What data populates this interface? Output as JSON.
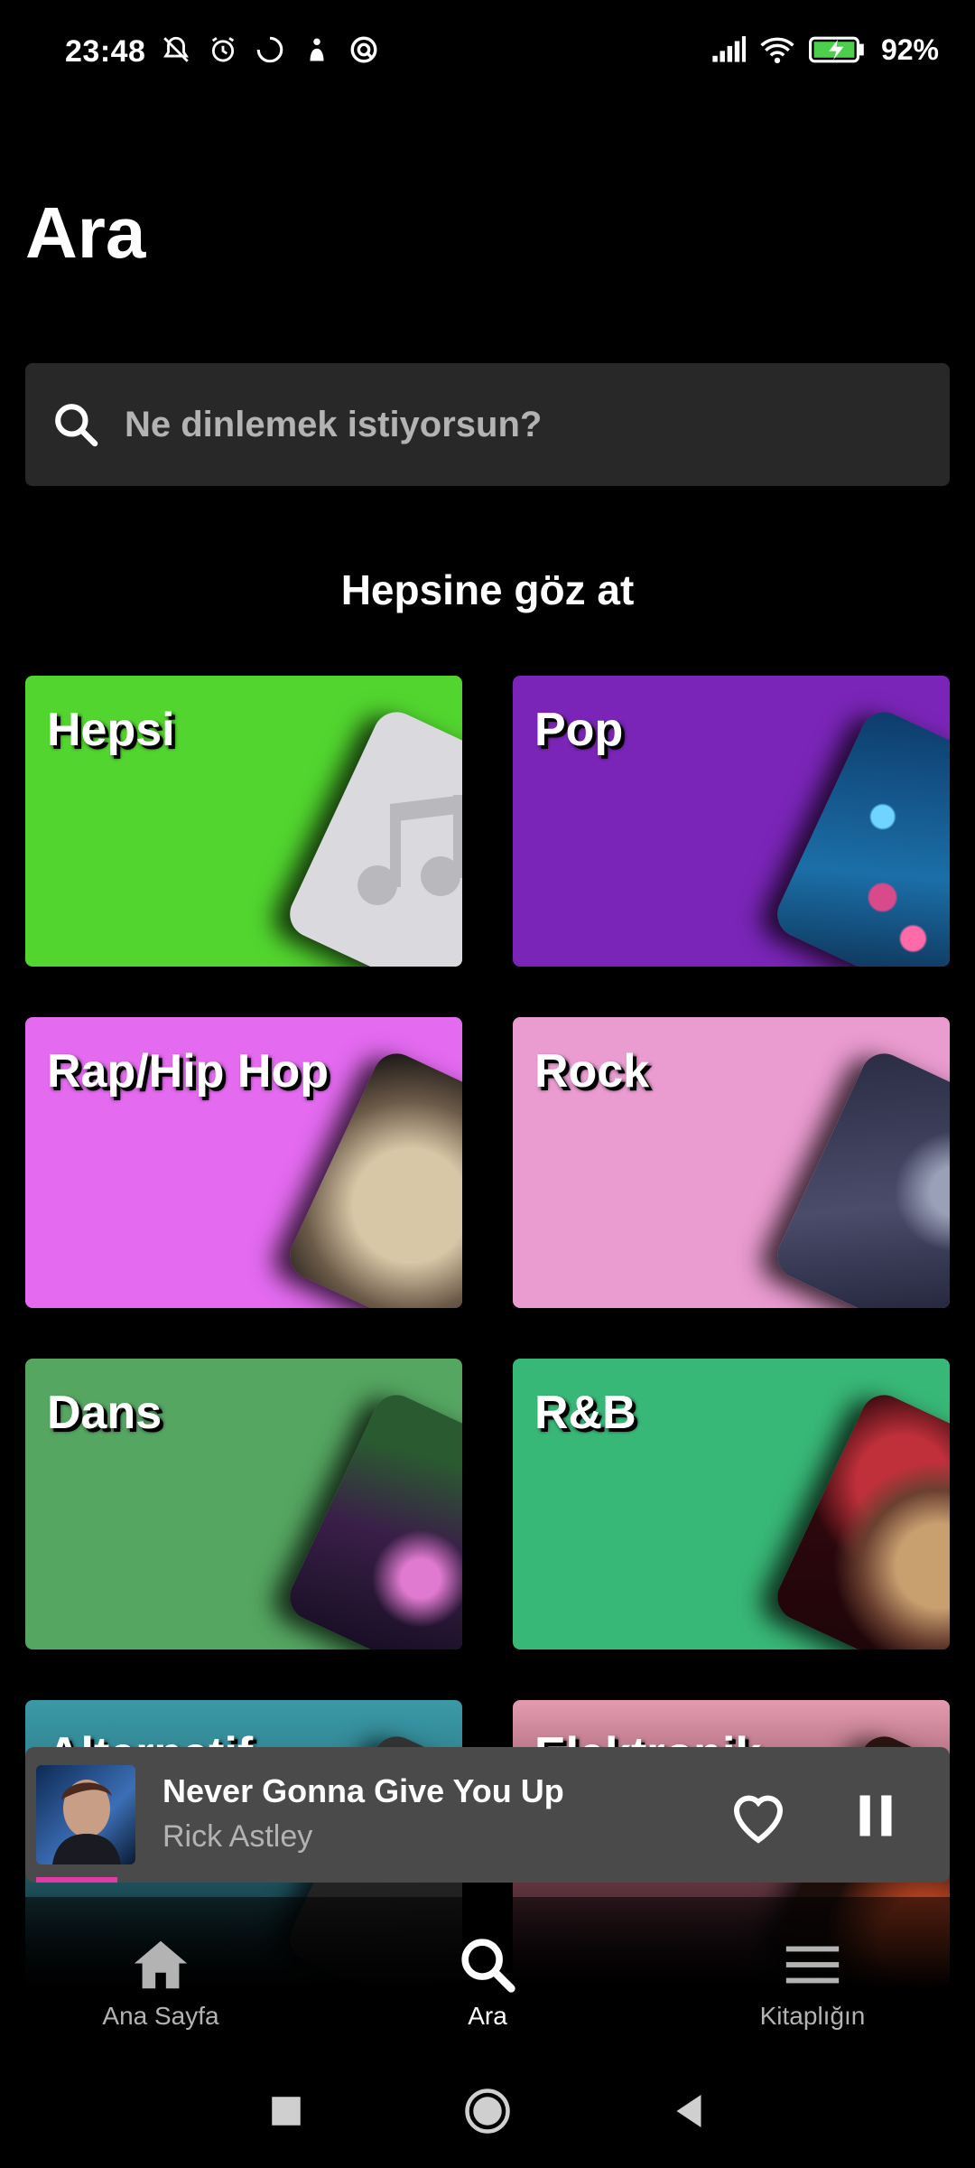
{
  "status_bar": {
    "time": "23:48",
    "battery": "92%",
    "left_icons": [
      "bell-off-icon",
      "alarm-icon",
      "loading-icon",
      "person-icon",
      "vpn-icon"
    ],
    "right_icons": [
      "signal-icon",
      "wifi-icon",
      "battery-charging-icon"
    ]
  },
  "header": {
    "title": "Ara"
  },
  "search": {
    "placeholder": "Ne dinlemek istiyorsun?"
  },
  "browse": {
    "heading": "Hepsine göz at",
    "tiles": [
      {
        "label": "Hepsi",
        "color": "#52d62f"
      },
      {
        "label": "Pop",
        "color": "#7a25b8"
      },
      {
        "label": "Rap/Hip Hop",
        "color": "#e46af0"
      },
      {
        "label": "Rock",
        "color": "#ea9bd0"
      },
      {
        "label": "Dans",
        "color": "#55a661"
      },
      {
        "label": "R&B",
        "color": "#38b877"
      },
      {
        "label": "Alternatif",
        "color": "#3a9aa6"
      },
      {
        "label": "Elektronik",
        "color": "#e49bb0"
      }
    ]
  },
  "player": {
    "title": "Never Gonna Give You Up",
    "artist": "Rick Astley",
    "progress": 0.09
  },
  "bottom_nav": {
    "items": [
      {
        "label": "Ana Sayfa",
        "icon": "home-icon"
      },
      {
        "label": "Ara",
        "icon": "search-icon"
      },
      {
        "label": "Kitaplığın",
        "icon": "library-icon"
      }
    ],
    "active": "Ara"
  },
  "system_nav": {
    "buttons": [
      "recents-icon",
      "home-circle-icon",
      "back-icon"
    ]
  }
}
